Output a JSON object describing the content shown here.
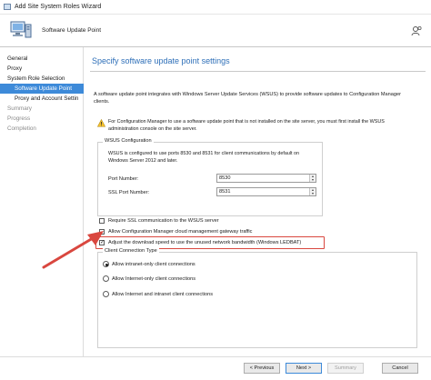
{
  "window": {
    "title": "Add Site System Roles Wizard"
  },
  "header": {
    "subtitle": "Software Update Point",
    "wizard_icon": "computer-wizard-icon",
    "help_icon": "user-help-icon"
  },
  "nav": {
    "items": [
      {
        "label": "General",
        "state": "done"
      },
      {
        "label": "Proxy",
        "state": "done"
      },
      {
        "label": "System Role Selection",
        "state": "done"
      },
      {
        "label": "Software Update Point",
        "state": "active"
      },
      {
        "label": "Proxy and Account Settin",
        "state": "done"
      },
      {
        "label": "Summary",
        "state": "pending"
      },
      {
        "label": "Progress",
        "state": "pending"
      },
      {
        "label": "Completion",
        "state": "pending"
      }
    ]
  },
  "main": {
    "title": "Specify software update point settings",
    "intro": "A software update point integrates with Windows Server Update Services (WSUS) to provide software updates to Configuration Manager clients.",
    "notice": "For Configuration Manager to use a software update point that is not installed on the site server, you must first install the WSUS administration console on the site server.",
    "wsus": {
      "group_label": "WSUS Configuration",
      "note": "WSUS is configured to use ports 8530 and 8531 for client communications by default on Windows Server 2012 and later.",
      "port_label": "Port Number:",
      "port_value": "8530",
      "ssl_port_label": "SSL Port Number:",
      "ssl_port_value": "8531"
    },
    "checkboxes": [
      {
        "label": "Require SSL communication to the WSUS server",
        "checked": false
      },
      {
        "label": "Allow Configuration Manager cloud management gateway traffic",
        "checked": false
      },
      {
        "label": "Adjust the download speed to use the unused network bandwidth (Windows LEDBAT)",
        "checked": true
      }
    ],
    "client_connection": {
      "group_label": "Client Connection Type",
      "options": [
        {
          "label": "Allow intranet-only client connections",
          "selected": true
        },
        {
          "label": "Allow Internet-only client connections",
          "selected": false
        },
        {
          "label": "Allow Internet and intranet client connections",
          "selected": false
        }
      ]
    }
  },
  "footer": {
    "previous": "< Previous",
    "next": "Next >",
    "summary": "Summary",
    "cancel": "Cancel"
  },
  "colors": {
    "accent": "#3d8ad9",
    "title": "#2e6fb8",
    "annotation": "#d9473f"
  }
}
